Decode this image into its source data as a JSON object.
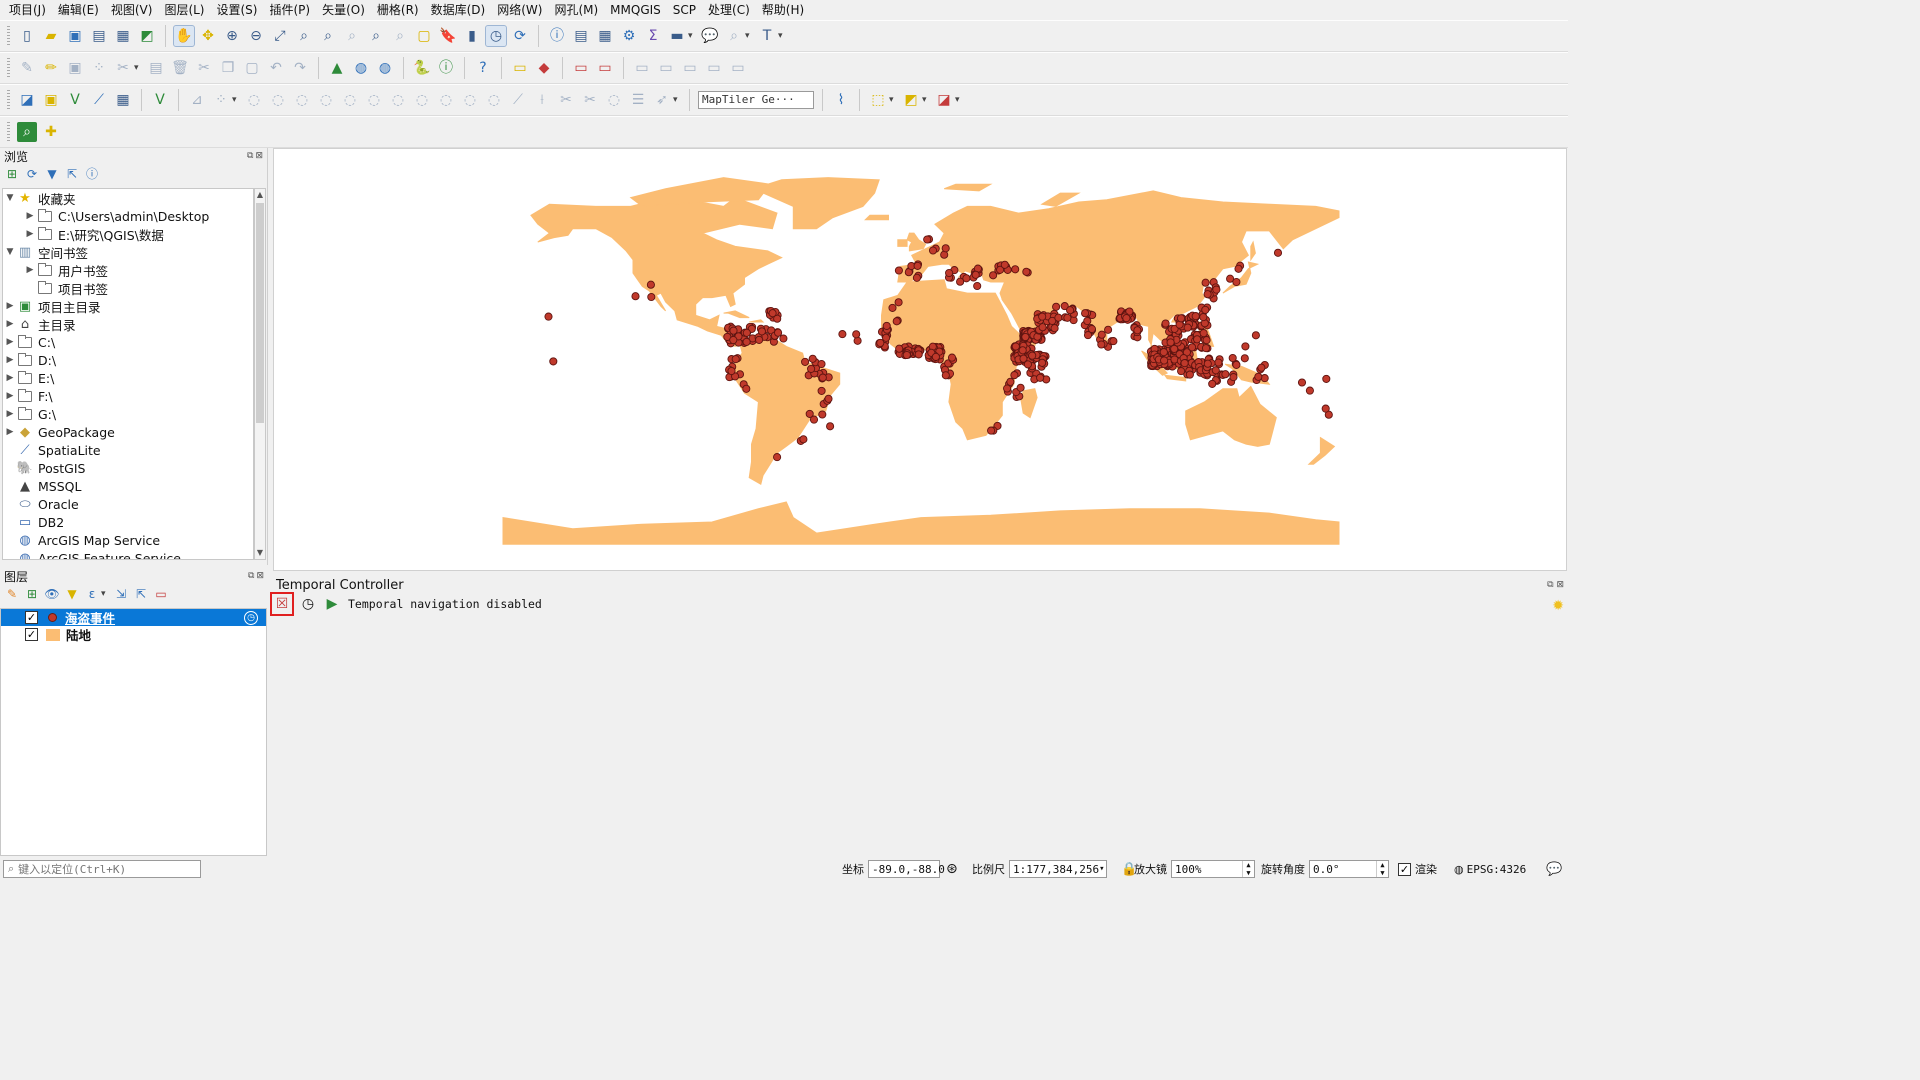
{
  "menubar": [
    "项目(J)",
    "编辑(E)",
    "视图(V)",
    "图层(L)",
    "设置(S)",
    "插件(P)",
    "矢量(O)",
    "栅格(R)",
    "数据库(D)",
    "网络(W)",
    "网孔(M)",
    "MMQGIS",
    "SCP",
    "处理(C)",
    "帮助(H)"
  ],
  "toolbar": {
    "map_source_combo": "MapTiler Ge···"
  },
  "browser": {
    "title": "浏览",
    "items": [
      {
        "label": "收藏夹",
        "icon": "star-icon",
        "depth": 0,
        "twisty": "expanded"
      },
      {
        "label": "C:\\Users\\admin\\Desktop",
        "icon": "folder-icon",
        "depth": 1,
        "twisty": "collapsed"
      },
      {
        "label": "E:\\研究\\QGIS\\数据",
        "icon": "folder-icon",
        "depth": 1,
        "twisty": "collapsed"
      },
      {
        "label": "空间书签",
        "icon": "bookmark-icon",
        "depth": 0,
        "twisty": "expanded"
      },
      {
        "label": "用户书签",
        "icon": "folder-icon",
        "depth": 1,
        "twisty": "collapsed"
      },
      {
        "label": "项目书签",
        "icon": "folder-icon",
        "depth": 1,
        "twisty": "none"
      },
      {
        "label": "项目主目录",
        "icon": "project-home-icon",
        "depth": 0,
        "twisty": "collapsed"
      },
      {
        "label": "主目录",
        "icon": "home-icon",
        "depth": 0,
        "twisty": "collapsed"
      },
      {
        "label": "C:\\",
        "icon": "folder-icon",
        "depth": 0,
        "twisty": "collapsed"
      },
      {
        "label": "D:\\",
        "icon": "folder-icon",
        "depth": 0,
        "twisty": "collapsed"
      },
      {
        "label": "E:\\",
        "icon": "folder-icon",
        "depth": 0,
        "twisty": "collapsed"
      },
      {
        "label": "F:\\",
        "icon": "folder-icon",
        "depth": 0,
        "twisty": "collapsed"
      },
      {
        "label": "G:\\",
        "icon": "folder-icon",
        "depth": 0,
        "twisty": "collapsed"
      },
      {
        "label": "GeoPackage",
        "icon": "geopackage-icon",
        "depth": 0,
        "twisty": "collapsed"
      },
      {
        "label": "SpatiaLite",
        "icon": "spatialite-icon",
        "depth": 0,
        "twisty": "none"
      },
      {
        "label": "PostGIS",
        "icon": "postgis-icon",
        "depth": 0,
        "twisty": "none"
      },
      {
        "label": "MSSQL",
        "icon": "mssql-icon",
        "depth": 0,
        "twisty": "none"
      },
      {
        "label": "Oracle",
        "icon": "oracle-icon",
        "depth": 0,
        "twisty": "none"
      },
      {
        "label": "DB2",
        "icon": "db2-icon",
        "depth": 0,
        "twisty": "none"
      },
      {
        "label": "ArcGIS Map Service",
        "icon": "arcgis-icon",
        "depth": 0,
        "twisty": "none"
      },
      {
        "label": "ArcGIS Feature Service",
        "icon": "arcgis-icon",
        "depth": 0,
        "twisty": "none"
      }
    ]
  },
  "layers": {
    "title": "图层",
    "items": [
      {
        "label": "海盗事件",
        "checked": true,
        "selected": true,
        "symbol": "point",
        "temporal": true
      },
      {
        "label": "陆地",
        "checked": true,
        "selected": false,
        "symbol": "polygon",
        "temporal": false
      }
    ]
  },
  "map": {
    "land_color": "#fbbd73",
    "point_color": "#c0392b",
    "point_stroke": "#5e1410",
    "background": "#ffffff"
  },
  "temporal": {
    "title": "Temporal Controller",
    "status": "Temporal navigation disabled"
  },
  "status": {
    "locator_placeholder": "键入以定位(Ctrl+K)",
    "coord_label": "坐标",
    "coord_value": "-89.0,-88.0",
    "scale_label": "比例尺",
    "scale_value": "1:177,384,256",
    "magnifier_label": "放大镜",
    "magnifier_value": "100%",
    "rotation_label": "旋转角度",
    "rotation_value": "0.0°",
    "render_label": "渲染",
    "crs": "EPSG:4326"
  },
  "colors": {
    "selection": "#0a78d7",
    "highlight_box": "#e02020"
  }
}
